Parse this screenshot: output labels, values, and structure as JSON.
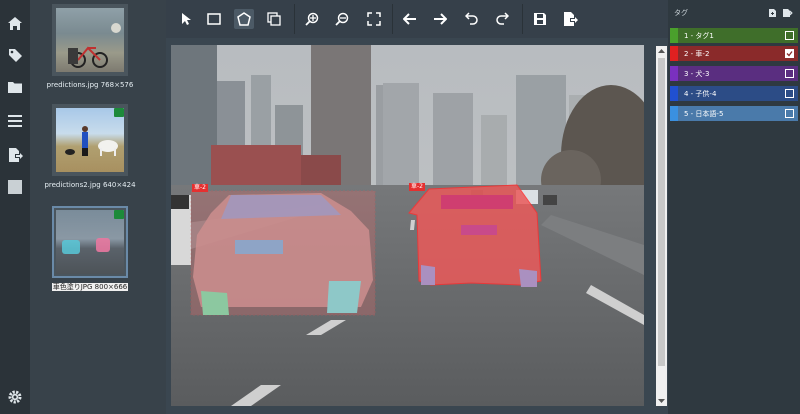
{
  "thumbnails": [
    {
      "caption": "predictions.jpg 768×576",
      "tagged": false,
      "active": false
    },
    {
      "caption": "predictions2.jpg 640×424",
      "tagged": true,
      "active": false
    },
    {
      "caption": "車色塗りJPG 800×666",
      "tagged": true,
      "active": true
    }
  ],
  "tags_panel": {
    "title": "タグ",
    "items": [
      {
        "label": "1 - タグ1",
        "color": "#4aa02c",
        "bg": "#3f6e2a",
        "checked": false
      },
      {
        "label": "2 - 車-2",
        "color": "#e02020",
        "bg": "#8a2a2a",
        "checked": true
      },
      {
        "label": "3 - 犬-3",
        "color": "#7a30c0",
        "bg": "#5a2e80",
        "checked": false
      },
      {
        "label": "4 - 子供-4",
        "color": "#2050d0",
        "bg": "#2c4c86",
        "checked": false
      },
      {
        "label": "5 - 日本語-5",
        "color": "#3a90e0",
        "bg": "#4a7aaa",
        "checked": false
      }
    ]
  },
  "annotations": [
    {
      "label": "車-2"
    },
    {
      "label": "車-2"
    }
  ]
}
